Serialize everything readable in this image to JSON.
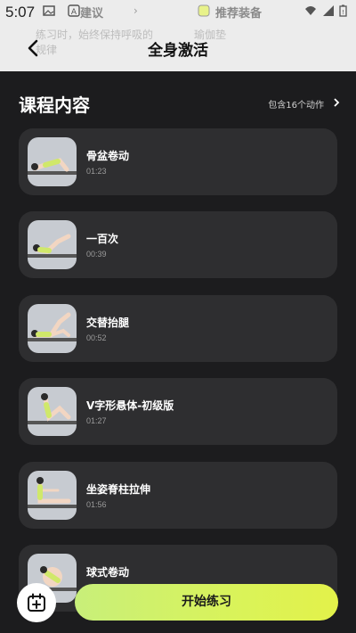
{
  "status_bar": {
    "time": "5:07"
  },
  "background_ghost": {
    "left_line1": "练习时，始终保持呼吸的",
    "left_line2": "规律",
    "middle_heading": "建议",
    "right_heading": "推荐装备",
    "right_item": "瑜伽垫"
  },
  "header": {
    "title": "全身激活"
  },
  "section": {
    "title": "课程内容",
    "count_label": "包含16个动作"
  },
  "exercises": [
    {
      "name": "骨盆卷动",
      "duration": "01:23"
    },
    {
      "name": "一百次",
      "duration": "00:39"
    },
    {
      "name": "交替抬腿",
      "duration": "00:52"
    },
    {
      "name": "V字形悬体-初级版",
      "duration": "01:27"
    },
    {
      "name": "坐姿脊柱拉伸",
      "duration": "01:56"
    },
    {
      "name": "球式卷动",
      "duration": ""
    }
  ],
  "bottom": {
    "start_label": "开始练习",
    "schedule_icon": "calendar-add-icon"
  },
  "colors": {
    "accent_start": "#c8ef7a",
    "accent_end": "#e3f24a",
    "card_bg": "#2e2e30",
    "page_bg": "#1c1c1e"
  }
}
